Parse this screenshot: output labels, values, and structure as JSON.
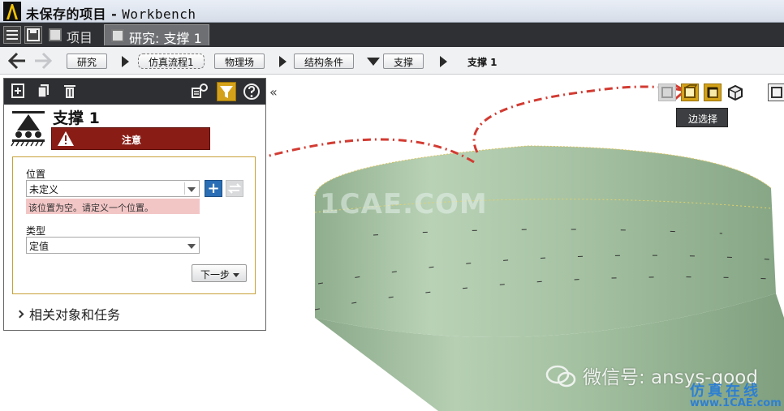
{
  "window": {
    "title": "未保存的项目",
    "separator": " - ",
    "app_name": "Workbench"
  },
  "tabs": [
    {
      "label": "项目"
    },
    {
      "label": "研究: 支撑 1"
    }
  ],
  "breadcrumb": {
    "items": [
      "研究",
      "仿真流程1",
      "物理场",
      "结构条件",
      "支撑"
    ],
    "current": "支撑 1"
  },
  "panel": {
    "title": "支撑 1",
    "warning_label": "注意",
    "location": {
      "label": "位置",
      "value": "未定义",
      "error": "该位置为空。请定义一个位置。"
    },
    "type": {
      "label": "类型",
      "value": "定值"
    },
    "next_label": "下一步",
    "related_label": "相关对象和任务"
  },
  "viewport": {
    "tooltip": "边选择",
    "watermark": "1CAE.COM",
    "wechat_text": "微信号: ansys-good",
    "footer_brand": "仿真在线",
    "footer_url": "www.1CAE.com"
  },
  "colors": {
    "warning_banner": "#8a1c16",
    "accent_blue": "#2a6eb5",
    "selection_active": "#d4a21a",
    "model_green": "#a9c4a7",
    "annotation_red": "#d23b32"
  },
  "icons": {
    "app_logo": "ansys-logo-icon",
    "support": "fixed-support-icon",
    "warning": "warning-triangle-icon",
    "filter": "filter-icon",
    "help": "help-icon"
  }
}
